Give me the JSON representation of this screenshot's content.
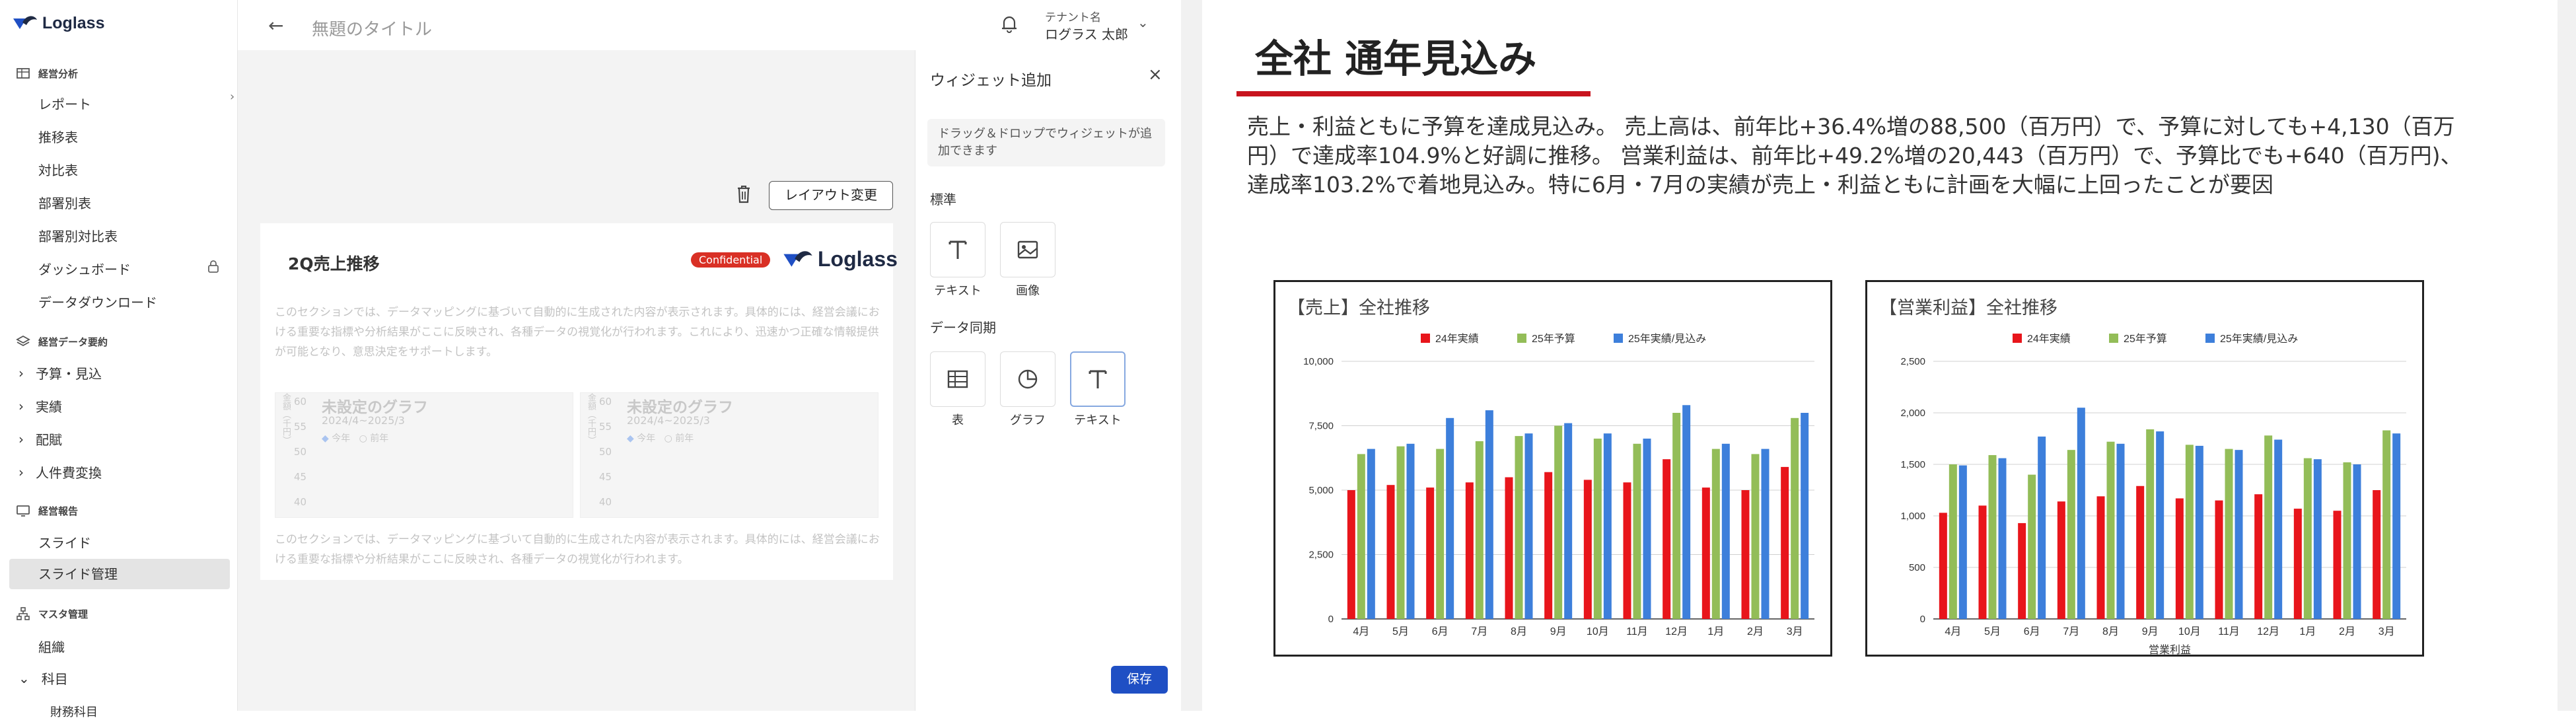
{
  "app": {
    "logo": "Loglass"
  },
  "sidebar": {
    "sections": [
      {
        "label": "経営分析",
        "items": [
          "レポート",
          "推移表",
          "対比表",
          "部署別表",
          "部署別対比表",
          "ダッシュボード",
          "データダウンロード"
        ]
      },
      {
        "label": "経営データ要約",
        "items": [
          "予算・見込",
          "実績",
          "配賦",
          "人件費変換"
        ]
      },
      {
        "label": "経営報告",
        "items": [
          "スライド",
          "スライド管理"
        ]
      },
      {
        "label": "マスタ管理",
        "items": [
          "組織",
          "科目",
          "財務科目"
        ]
      }
    ]
  },
  "header": {
    "title": "無題のタイトル",
    "tenant_label": "テナント名",
    "tenant_user": "ログラス 太郎"
  },
  "editor": {
    "layout_button": "レイアウト変更",
    "preview_title": "2Q売上推移",
    "badge": "Confidential",
    "placeholder_1": "このセクションでは、データマッピングに基づいて自動的に生成された内容が表示されます。具体的には、経営会議における重要な指標や分析結果がここに反映され、各種データの視覚化が行われます。これにより、迅速かつ正確な情報提供が可能となり、意思決定をサポートします。",
    "placeholder_2": "このセクションでは、データマッピングに基づいて自動的に生成された内容が表示されます。具体的には、経営会議における重要な指標や分析結果がここに反映され、各種データの視覚化が行われます。",
    "mini_chart": {
      "title": "未設定のグラフ",
      "subtitle": "2024/4~2025/3",
      "legend": [
        "今年",
        "前年"
      ],
      "ticks": [
        "60",
        "55",
        "50",
        "45",
        "40"
      ],
      "axis": "金額（千円）"
    }
  },
  "panel": {
    "title": "ウィジェット追加",
    "hint": "ドラッグ＆ドロップでウィジェットが追加できます",
    "standard_label": "標準",
    "standard_tiles": [
      "テキスト",
      "画像"
    ],
    "sync_label": "データ同期",
    "sync_tiles": [
      "表",
      "グラフ",
      "テキスト"
    ],
    "save": "保存"
  },
  "slide": {
    "title": "全社 通年見込み",
    "description": "売上・利益ともに予算を達成見込み。 売上高は、前年比+36.4%増の88,500（百万円）で、予算に対しても+4,130（百万円）で達成率104.9%と好調に推移。 営業利益は、前年比+49.2%増の20,443（百万円）で、予算比でも+640（百万円)、達成率103.2%で着地見込み。特に6月・7月の実績が売上・利益ともに計画を大幅に上回ったことが要因"
  },
  "colors": {
    "actual24": "#e8151b",
    "budget25": "#93bd58",
    "forecast25": "#3d7fdb",
    "accent": "#c8141e",
    "save": "#1f4fc4"
  },
  "chart_data": [
    {
      "type": "bar",
      "title": "【売上】全社推移",
      "categories": [
        "4月",
        "5月",
        "6月",
        "7月",
        "8月",
        "9月",
        "10月",
        "11月",
        "12月",
        "1月",
        "2月",
        "3月"
      ],
      "series": [
        {
          "name": "24年実績",
          "values": [
            5000,
            5200,
            5100,
            5300,
            5500,
            5700,
            5400,
            5300,
            6200,
            5100,
            5000,
            5900
          ]
        },
        {
          "name": "25年予算",
          "values": [
            6400,
            6700,
            6600,
            6900,
            7100,
            7500,
            7000,
            6800,
            8000,
            6600,
            6400,
            7800
          ]
        },
        {
          "name": "25年実績/見込み",
          "values": [
            6600,
            6800,
            7800,
            8100,
            7200,
            7600,
            7200,
            7000,
            8300,
            6800,
            6600,
            8000
          ]
        }
      ],
      "ylim": [
        0,
        10000
      ],
      "yticks": [
        "0",
        "2,500",
        "5,000",
        "7,500",
        "10,000"
      ],
      "xlabel": "",
      "legend": "top"
    },
    {
      "type": "bar",
      "title": "【営業利益】全社推移",
      "categories": [
        "4月",
        "5月",
        "6月",
        "7月",
        "8月",
        "9月",
        "10月",
        "11月",
        "12月",
        "1月",
        "2月",
        "3月"
      ],
      "series": [
        {
          "name": "24年実績",
          "values": [
            1030,
            1100,
            930,
            1140,
            1190,
            1290,
            1170,
            1150,
            1210,
            1070,
            1050,
            1250
          ]
        },
        {
          "name": "25年予算",
          "values": [
            1500,
            1590,
            1400,
            1640,
            1720,
            1840,
            1690,
            1650,
            1780,
            1560,
            1520,
            1830
          ]
        },
        {
          "name": "25年実績/見込み",
          "values": [
            1490,
            1560,
            1770,
            2050,
            1700,
            1820,
            1680,
            1640,
            1740,
            1550,
            1500,
            1800
          ]
        }
      ],
      "ylim": [
        0,
        2500
      ],
      "yticks": [
        "0",
        "500",
        "1,000",
        "1,500",
        "2,000",
        "2,500"
      ],
      "xlabel": "営業利益",
      "legend": "top"
    }
  ]
}
